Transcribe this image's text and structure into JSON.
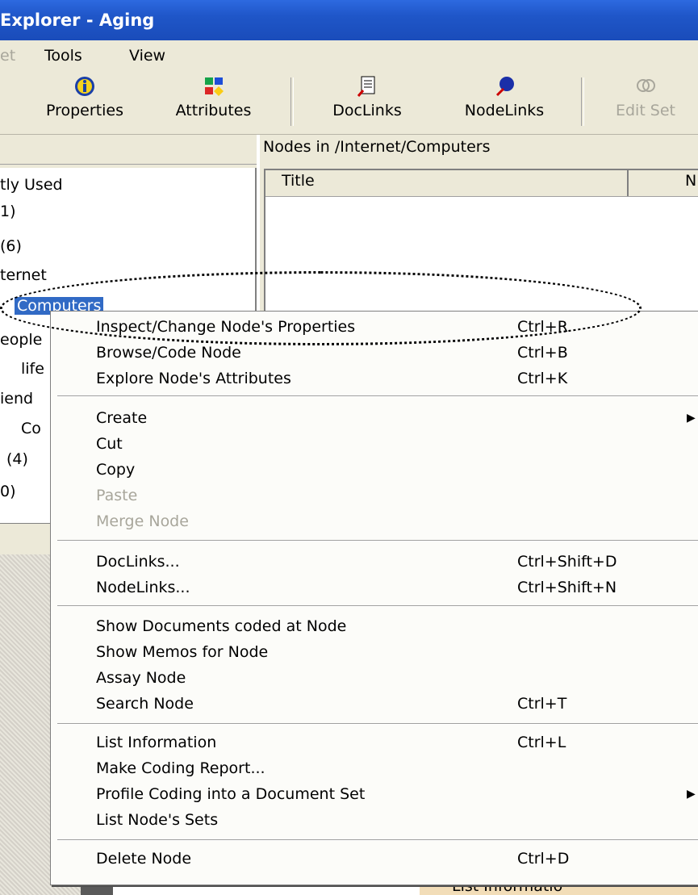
{
  "window": {
    "title": "Explorer - Aging"
  },
  "menubar": {
    "items": [
      "et",
      "Tools",
      "View"
    ]
  },
  "toolbar": {
    "buttons": [
      {
        "label": "Properties",
        "icon": "info-icon"
      },
      {
        "label": "Attributes",
        "icon": "attributes-icon"
      },
      {
        "label": "DocLinks",
        "icon": "doclinks-icon"
      },
      {
        "label": "NodeLinks",
        "icon": "nodelinks-icon"
      },
      {
        "label": "Edit Set",
        "icon": "edit-set-icon",
        "disabled": true
      }
    ]
  },
  "tree": {
    "items": [
      "tly Used",
      "1)",
      "(6)",
      "ternet",
      "Computers",
      "eople",
      "life",
      "iend",
      "Co",
      "(4)",
      "0)"
    ],
    "selected": "Computers"
  },
  "right_pane": {
    "title": "Nodes in /Internet/Computers",
    "columns": [
      "Title",
      "N"
    ]
  },
  "context_menu": {
    "items": [
      {
        "label": "Inspect/Change Node's Properties",
        "shortcut": "Ctrl+R"
      },
      {
        "label": "Browse/Code Node",
        "shortcut": "Ctrl+B"
      },
      {
        "label": "Explore Node's Attributes",
        "shortcut": "Ctrl+K"
      },
      {
        "label": "Create",
        "submenu": true
      },
      {
        "label": "Cut"
      },
      {
        "label": "Copy"
      },
      {
        "label": "Paste",
        "disabled": true
      },
      {
        "label": "Merge Node",
        "disabled": true
      },
      {
        "label": "DocLinks...",
        "shortcut": "Ctrl+Shift+D"
      },
      {
        "label": "NodeLinks...",
        "shortcut": "Ctrl+Shift+N"
      },
      {
        "label": "Show Documents coded at Node"
      },
      {
        "label": "Show Memos for Node"
      },
      {
        "label": "Assay Node"
      },
      {
        "label": "Search Node",
        "shortcut": "Ctrl+T"
      },
      {
        "label": "List Information",
        "shortcut": "Ctrl+L"
      },
      {
        "label": "Make Coding Report..."
      },
      {
        "label": "Profile Coding into a Document Set",
        "submenu": true
      },
      {
        "label": "List Node's Sets"
      },
      {
        "label": "Delete Node",
        "shortcut": "Ctrl+D"
      }
    ]
  },
  "bottom_partial_text": "List Informatio",
  "colors": {
    "title_bar": "#1f56c8",
    "selection": "#316ac5",
    "face": "#ece9d8"
  }
}
